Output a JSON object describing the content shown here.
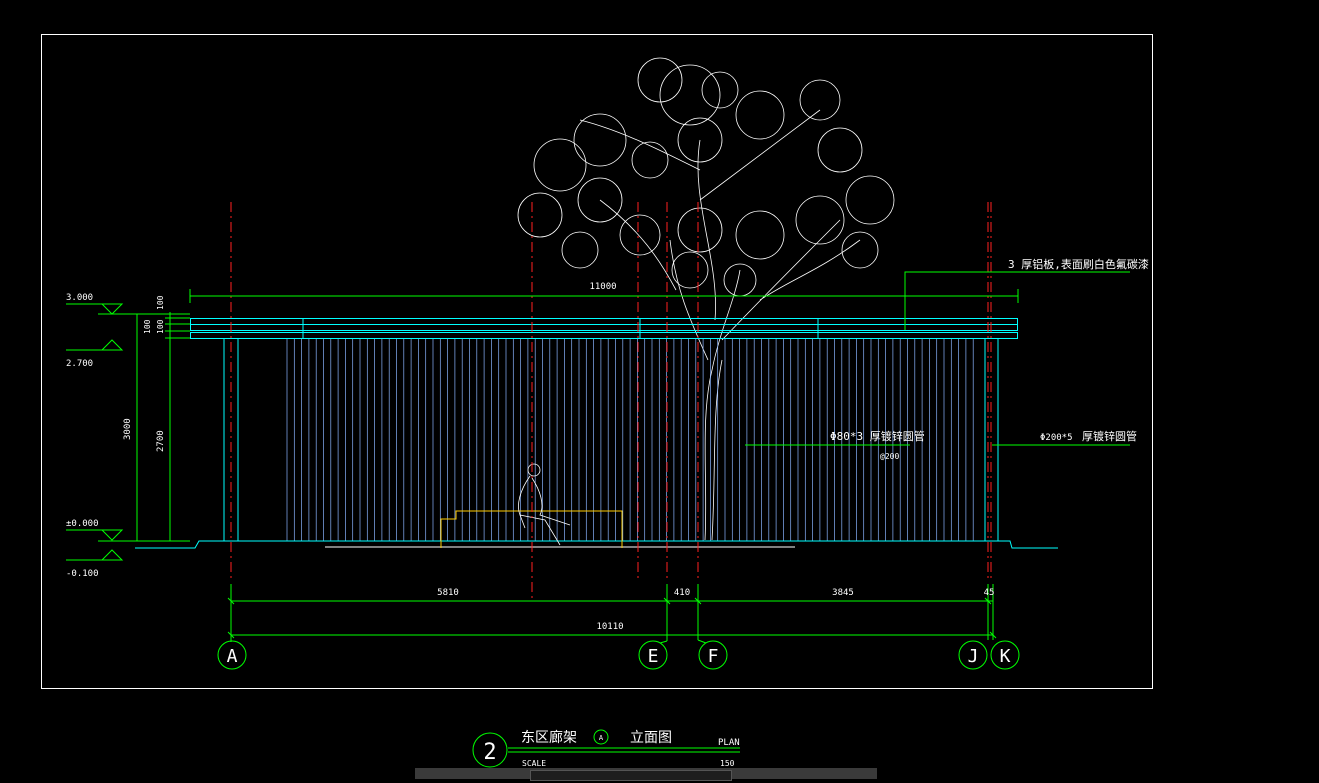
{
  "colors": {
    "background": "#000000",
    "frame": "#ffffff",
    "dimension": "#00ff00",
    "axis": "#ff2020",
    "structure": "#00ffff",
    "slats": "#8ab4ff",
    "bench": "#ffcc00",
    "text": "#ffffff"
  },
  "elevations": {
    "top": "3.000",
    "mid": "2.700",
    "ground": "±0.000",
    "below": "-0.100"
  },
  "dimensions": {
    "overall_top": "11000",
    "small_a": "100",
    "small_b": "100",
    "small_c": "100",
    "height_total": "3000",
    "height_column": "2700",
    "seg_1": "5810",
    "seg_2": "410",
    "seg_3": "3845",
    "seg_4": "45",
    "overall_bottom": "10110"
  },
  "annotations": {
    "roof_note": "3 厚铝板,表面刷白色氟碳漆",
    "mid_spec": "Φ80*3  厚镀锌圆管",
    "mid_spacing": "@200",
    "right_spec_size": "Φ200*5",
    "right_spec_text": "厚镀锌圆管"
  },
  "axes": [
    "A",
    "E",
    "F",
    "J",
    "K"
  ],
  "title_block": {
    "number": "2",
    "name": "东区廊架",
    "ref": "A",
    "suffix": "立面图",
    "plan_label": "PLAN",
    "scale_label": "SCALE",
    "scale_value": "150"
  }
}
